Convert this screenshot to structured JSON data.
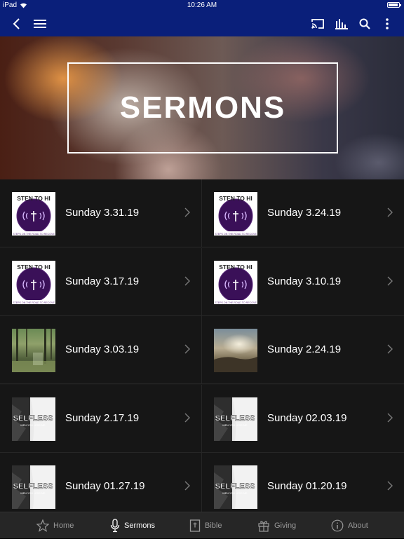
{
  "status_bar": {
    "device": "iPad",
    "time": "10:26 AM"
  },
  "nav_icons": [
    "back-icon",
    "menu-icon",
    "cast-icon",
    "audio-bars-icon",
    "search-icon",
    "more-vertical-icon"
  ],
  "hero": {
    "title": "SERMONS"
  },
  "sermons": [
    {
      "label": "Sunday 3.31.19",
      "thumb": "listen"
    },
    {
      "label": "Sunday 3.24.19",
      "thumb": "listen"
    },
    {
      "label": "Sunday 3.17.19",
      "thumb": "listen"
    },
    {
      "label": "Sunday 3.10.19",
      "thumb": "listen"
    },
    {
      "label": "Sunday 3.03.19",
      "thumb": "forest"
    },
    {
      "label": "Sunday 2.24.19",
      "thumb": "sky"
    },
    {
      "label": "Sunday 2.17.19",
      "thumb": "selfless"
    },
    {
      "label": "Sunday 02.03.19",
      "thumb": "selfless"
    },
    {
      "label": "Sunday 01.27.19",
      "thumb": "selfless"
    },
    {
      "label": "Sunday 01.20.19",
      "thumb": "selfless"
    }
  ],
  "thumb_text": {
    "listen_top": "STEN TO HI",
    "listen_bottom": "STEPS ON THE ROAD TO RECOVE",
    "selfless_title": "SELFLESS",
    "selfless_sub": "MEN YOU LESS ME"
  },
  "tabs": [
    {
      "label": "Home",
      "icon": "star-icon",
      "active": false
    },
    {
      "label": "Sermons",
      "icon": "microphone-icon",
      "active": true
    },
    {
      "label": "Bible",
      "icon": "bible-icon",
      "active": false
    },
    {
      "label": "Giving",
      "icon": "gift-icon",
      "active": false
    },
    {
      "label": "About",
      "icon": "info-icon",
      "active": false
    }
  ],
  "colors": {
    "nav_bg": "#0a1f7a",
    "grid_bg": "#161616",
    "tab_bg": "#262626",
    "purple": "#4a1a6b"
  }
}
